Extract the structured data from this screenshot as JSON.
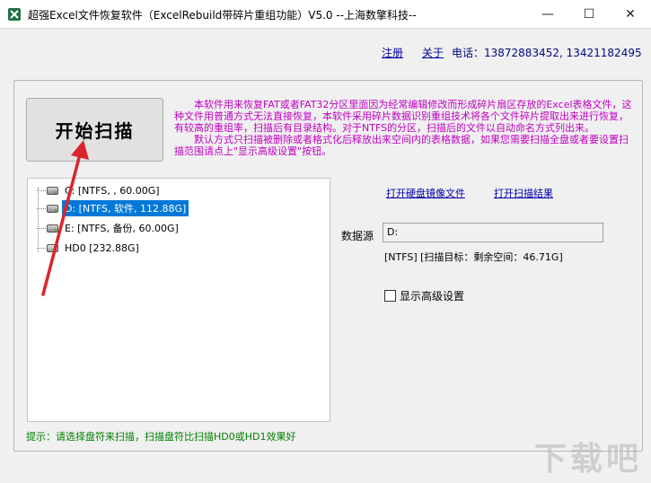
{
  "window": {
    "title": "超强Excel文件恢复软件（ExcelRebuild带碎片重组功能）V5.0  --上海数擎科技--",
    "minimize_glyph": "—",
    "maximize_glyph": "☐",
    "close_glyph": "✕"
  },
  "header": {
    "register": "注册",
    "about": "关于",
    "phone": "电话：13872883452, 13421182495"
  },
  "scan_button": {
    "label": "开始扫描"
  },
  "description": {
    "paragraph1": "本软件用来恢复FAT或者FAT32分区里面因为经常编辑修改而形成碎片扇区存放的Excel表格文件，这种文件用普通方式无法直接恢复，本软件采用碎片数据识别重组技术将各个文件碎片提取出来进行恢复，有较高的重组率，扫描后有目录结构。对于NTFS的分区，扫描后的文件以自动命名方式列出来。",
    "paragraph2": "默认方式只扫描被删除或者格式化后释放出来空间内的表格数据，如果您需要扫描全盘或者要设置扫描范围请点上\"显示高级设置\"按钮。"
  },
  "drive_tree": {
    "items": [
      {
        "label": "C:  [NTFS, , 60.00G]",
        "selected": false,
        "icon": "drive-icon"
      },
      {
        "label": "D:  [NTFS, 软件, 112.88G]",
        "selected": true,
        "icon": "drive-icon"
      },
      {
        "label": "E:  [NTFS, 备份, 60.00G]",
        "selected": false,
        "icon": "drive-icon"
      },
      {
        "label": "HD0  [232.88G]",
        "selected": false,
        "icon": "hard-disk-icon"
      }
    ]
  },
  "links": {
    "open_disk_image": "打开硬盘镜像文件",
    "open_scan_result": "打开扫描结果"
  },
  "source": {
    "label": "数据源",
    "value": "D:",
    "info": "[NTFS]  [扫描目标：剩余空间：46.71G]"
  },
  "advanced": {
    "label": "显示高级设置",
    "checked": false
  },
  "hint": "提示：请选择盘符来扫描，扫描盘符比扫描HD0或HD1效果好",
  "watermark": "下载吧",
  "colors": {
    "description": "#c000c0",
    "hint": "#008000",
    "link": "#0000a8",
    "selection": "#0078d7",
    "arrow": "#d9262b"
  }
}
